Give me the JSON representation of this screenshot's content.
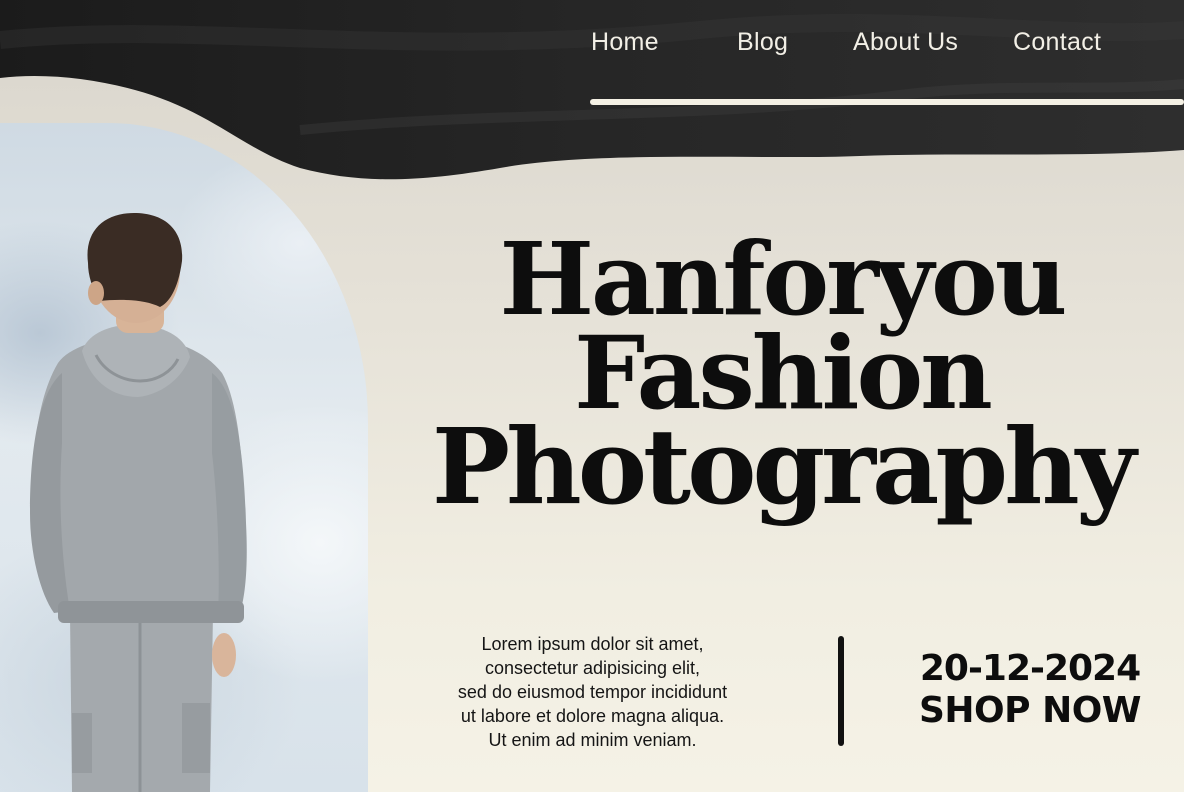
{
  "nav": {
    "items": [
      {
        "label": "Home"
      },
      {
        "label": "Blog"
      },
      {
        "label": "About Us"
      },
      {
        "label": "Contact"
      }
    ]
  },
  "hero": {
    "title_lines": [
      "Hanforyou",
      "Fashion",
      "Photography"
    ],
    "body_lines": [
      "Lorem ipsum dolor sit amet,",
      "consectetur adipisicing elit,",
      "sed do eiusmod tempor incididunt",
      "ut labore et dolore magna aliqua.",
      "Ut enim ad minim veniam."
    ],
    "date": "20-12-2024",
    "cta_label": "SHOP NOW"
  },
  "colors": {
    "background": "#efece1",
    "dark_band": "#1e1e1e",
    "text": "#0d0d0d",
    "nav_text": "#f2efe6"
  },
  "images": {
    "hero_photo": "person-in-grey-hoodie-back-view-photo"
  }
}
